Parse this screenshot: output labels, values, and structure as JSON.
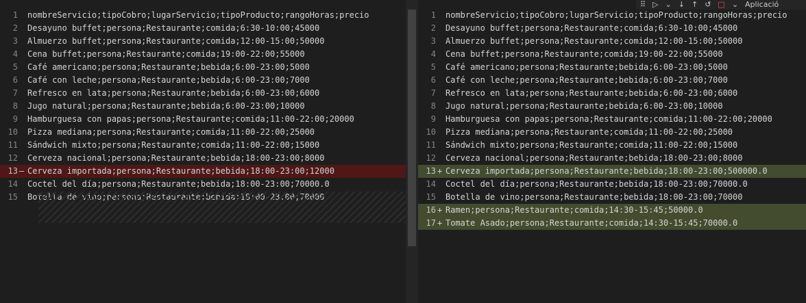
{
  "left": {
    "lines": [
      {
        "n": "1",
        "text": "nombreServicio;tipoCobro;lugarServicio;tipoProducto;rangoHoras;precio",
        "state": ""
      },
      {
        "n": "2",
        "text": "Desayuno buffet;persona;Restaurante;comida;6:30-10:00;45000",
        "state": ""
      },
      {
        "n": "3",
        "text": "Almuerzo buffet;persona;Restaurante;comida;12:00-15:00;50000",
        "state": ""
      },
      {
        "n": "4",
        "text": "Cena buffet;persona;Restaurante;comida;19:00-22:00;55000",
        "state": ""
      },
      {
        "n": "5",
        "text": "Café americano;persona;Restaurante;bebida;6:00-23:00;5000",
        "state": ""
      },
      {
        "n": "6",
        "text": "Café con leche;persona;Restaurante;bebida;6:00-23:00;7000",
        "state": ""
      },
      {
        "n": "7",
        "text": "Refresco en lata;persona;Restaurante;bebida;6:00-23:00;6000",
        "state": ""
      },
      {
        "n": "8",
        "text": "Jugo natural;persona;Restaurante;bebida;6:00-23:00;10000",
        "state": ""
      },
      {
        "n": "9",
        "text": "Hamburguesa con papas;persona;Restaurante;comida;11:00-22:00;20000",
        "state": ""
      },
      {
        "n": "10",
        "text": "Pizza mediana;persona;Restaurante;comida;11:00-22:00;25000",
        "state": ""
      },
      {
        "n": "11",
        "text": "Sándwich mixto;persona;Restaurante;comida;11:00-22:00;15000",
        "state": ""
      },
      {
        "n": "12",
        "text": "Cerveza nacional;persona;Restaurante;bebida;18:00-23:00;8000",
        "state": ""
      },
      {
        "n": "13",
        "text": "Cerveza importada;persona;Restaurante;bebida;18:00-23:00;12000",
        "state": "removed",
        "marker": "—"
      },
      {
        "n": "14",
        "text": "Coctel del día;persona;Restaurante;bebida;18:00-23:00;70000.0",
        "state": ""
      },
      {
        "n": "15",
        "text": "Botella de vino;persona;Restaurante;bebida;18:00-23:00;70000",
        "state": ""
      }
    ]
  },
  "right": {
    "lines": [
      {
        "n": "1",
        "text": "nombreServicio;tipoCobro;lugarServicio;tipoProducto;rangoHoras;precio",
        "state": ""
      },
      {
        "n": "2",
        "text": "Desayuno buffet;persona;Restaurante;comida;6:30-10:00;45000",
        "state": ""
      },
      {
        "n": "3",
        "text": "Almuerzo buffet;persona;Restaurante;comida;12:00-15:00;50000",
        "state": ""
      },
      {
        "n": "4",
        "text": "Cena buffet;persona;Restaurante;comida;19:00-22:00;55000",
        "state": ""
      },
      {
        "n": "5",
        "text": "Café americano;persona;Restaurante;bebida;6:00-23:00;5000",
        "state": ""
      },
      {
        "n": "6",
        "text": "Café con leche;persona;Restaurante;bebida;6:00-23:00;7000",
        "state": ""
      },
      {
        "n": "7",
        "text": "Refresco en lata;persona;Restaurante;bebida;6:00-23:00;6000",
        "state": ""
      },
      {
        "n": "8",
        "text": "Jugo natural;persona;Restaurante;bebida;6:00-23:00;10000",
        "state": ""
      },
      {
        "n": "9",
        "text": "Hamburguesa con papas;persona;Restaurante;comida;11:00-22:00;20000",
        "state": ""
      },
      {
        "n": "10",
        "text": "Pizza mediana;persona;Restaurante;comida;11:00-22:00;25000",
        "state": ""
      },
      {
        "n": "11",
        "text": "Sándwich mixto;persona;Restaurante;comida;11:00-22:00;15000",
        "state": ""
      },
      {
        "n": "12",
        "text": "Cerveza nacional;persona;Restaurante;bebida;18:00-23:00;8000",
        "state": ""
      },
      {
        "n": "13",
        "text": "Cerveza importada;persona;Restaurante;bebida;18:00-23:00;500000.0",
        "state": "added",
        "marker": "+",
        "arrow": "→"
      },
      {
        "n": "14",
        "text": "Coctel del día;persona;Restaurante;bebida;18:00-23:00;70000.0",
        "state": ""
      },
      {
        "n": "15",
        "text": "Botella de vino;persona;Restaurante;bebida;18:00-23:00;70000",
        "state": ""
      },
      {
        "n": "16",
        "text": "Ramen;persona;Restaurante;comida;14:30-15:45;50000.0",
        "state": "added",
        "marker": "+",
        "arrow": "→"
      },
      {
        "n": "17",
        "text": "Tomate Asado;persona;Restaurante;comida;14:30-15:45;70000.0",
        "state": "added",
        "marker": "+"
      }
    ]
  },
  "toolbar": {
    "label": "Aplicació",
    "icons": [
      "drag-handle-icon",
      "play-icon",
      "chevron-down-icon",
      "arrow-down-icon",
      "arrow-up-icon",
      "revert-icon",
      "stop-square-icon",
      "chevron-down-icon"
    ]
  },
  "colors": {
    "removed_bg": "#4b1818",
    "added_bg": "#373d29",
    "editor_bg": "#1e1e1e"
  }
}
